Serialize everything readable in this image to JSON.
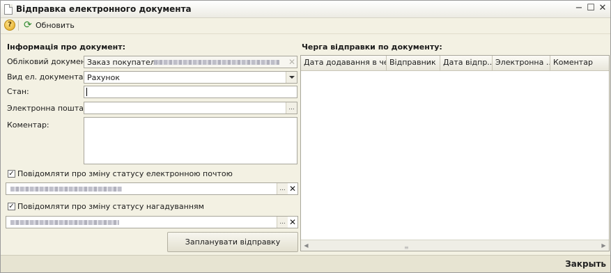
{
  "window": {
    "title": "Відправка електронного документа"
  },
  "toolbar": {
    "help_label": "?",
    "refresh_label": "Обновить"
  },
  "left": {
    "section_title": "Інформація про документ:",
    "doc_label": "Обліковий документ:",
    "doc_value": "Заказ покупателя",
    "type_label": "Вид ел. документа",
    "type_value": "Рахунок",
    "status_label": "Стан:",
    "status_value": "",
    "email_label": "Электронна пошта",
    "email_value": "",
    "comment_label": "Коментар:",
    "comment_value": "",
    "notify_email_label": "Повідомляти про зміну статусу електронною почтою",
    "notify_email_checked": true,
    "notify_reminder_label": "Повідомляти про зміну статусу нагадуванням",
    "notify_reminder_checked": true,
    "plan_button": "Запланувати відправку"
  },
  "right": {
    "section_title": "Черга відправки по документу:",
    "columns": [
      "Дата додавання в че...",
      "Відправник",
      "Дата відпр...",
      "Электронна ...",
      "Коментар"
    ]
  },
  "footer": {
    "close_label": "Закрыть"
  },
  "icons": {
    "window_icon": "document-icon",
    "refresh_icon": "refresh-icon",
    "help_icon": "help-icon"
  }
}
